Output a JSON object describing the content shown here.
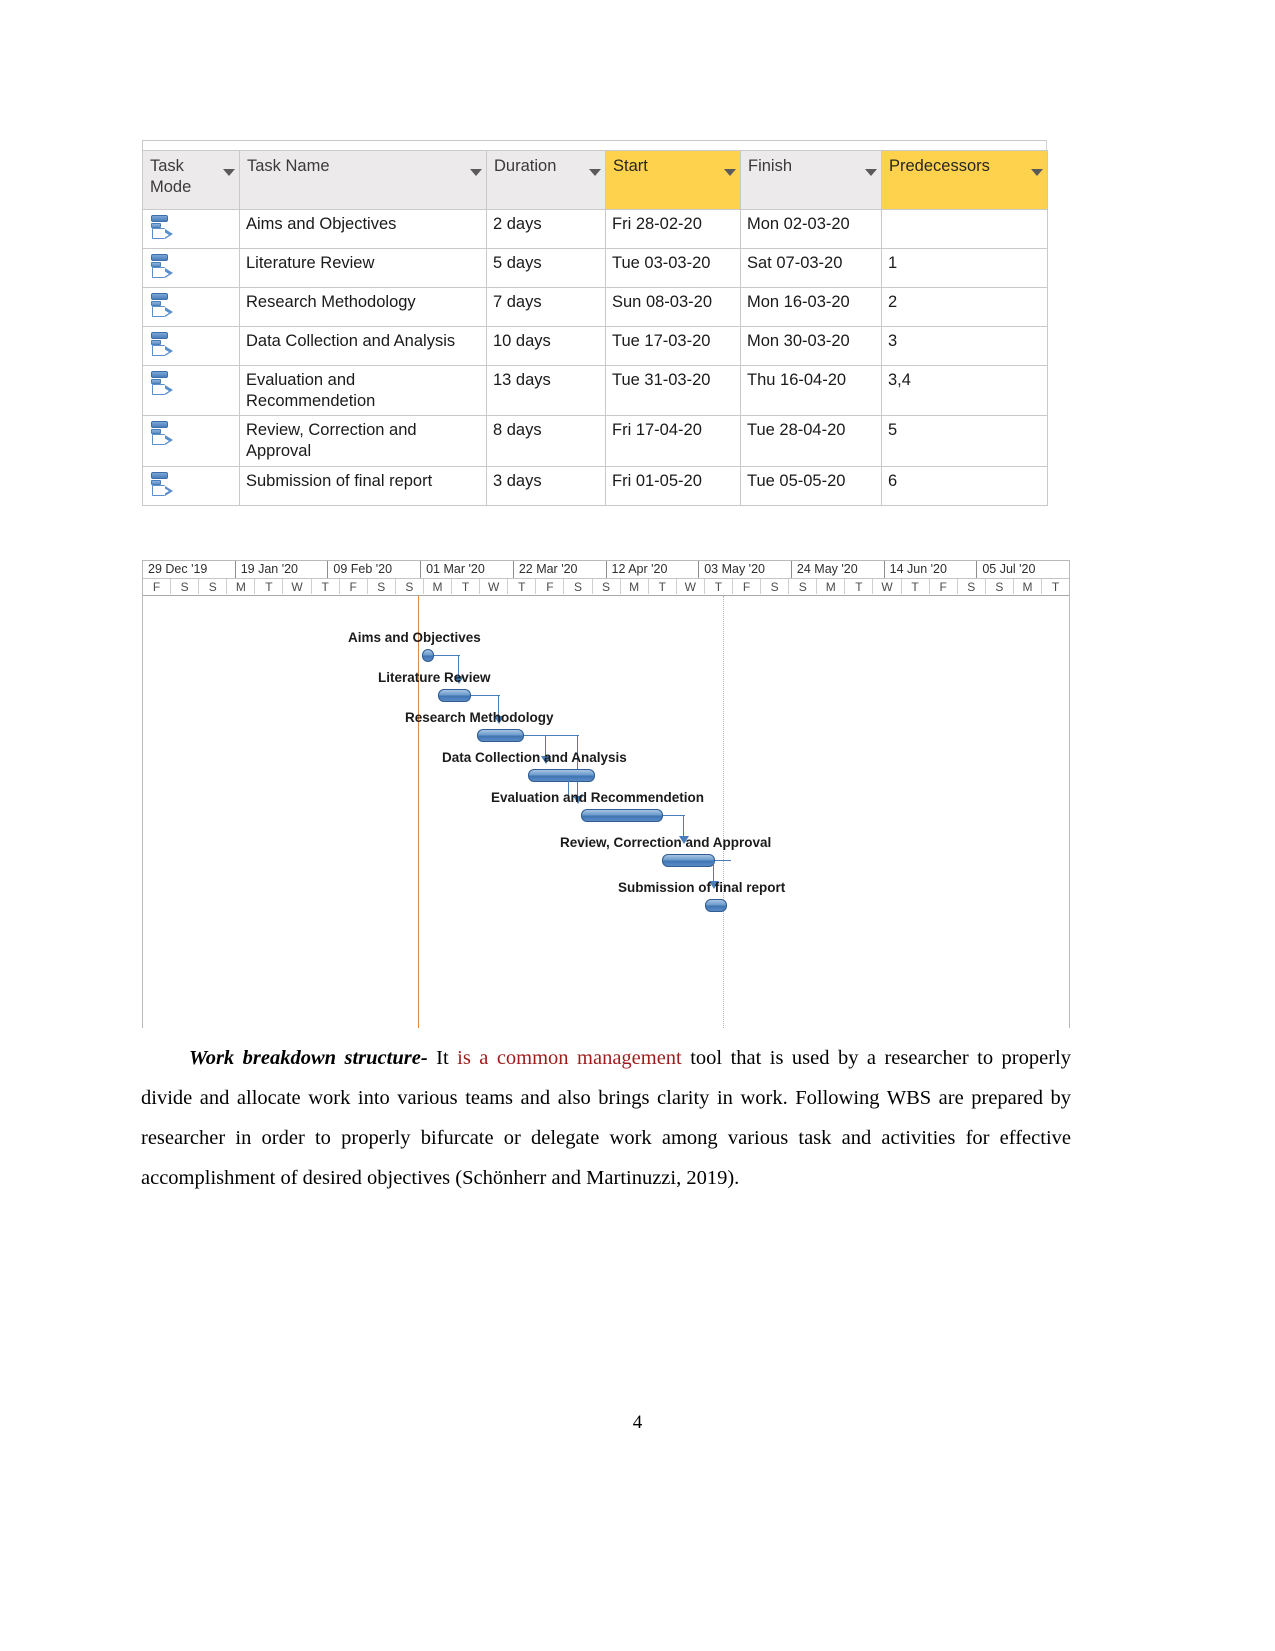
{
  "project_table": {
    "columns": [
      {
        "label": "Task\nMode",
        "highlighted": false,
        "has_filter": true
      },
      {
        "label": "Task Name",
        "highlighted": false,
        "has_filter": true
      },
      {
        "label": "Duration",
        "highlighted": false,
        "has_filter": true
      },
      {
        "label": "Start",
        "highlighted": true,
        "has_filter": true
      },
      {
        "label": "Finish",
        "highlighted": false,
        "has_filter": true
      },
      {
        "label": "Predecessors",
        "highlighted": true,
        "has_filter": true
      }
    ],
    "rows": [
      {
        "mode_icon": "auto-schedule-icon",
        "name": "Aims and Objectives",
        "duration": "2 days",
        "start": "Fri 28-02-20",
        "finish": "Mon 02-03-20",
        "predecessors": ""
      },
      {
        "mode_icon": "auto-schedule-icon",
        "name": "Literature Review",
        "duration": "5 days",
        "start": "Tue 03-03-20",
        "finish": "Sat 07-03-20",
        "predecessors": "1"
      },
      {
        "mode_icon": "auto-schedule-icon",
        "name": "Research Methodology",
        "duration": "7 days",
        "start": "Sun 08-03-20",
        "finish": "Mon 16-03-20",
        "predecessors": "2"
      },
      {
        "mode_icon": "auto-schedule-icon",
        "name": "Data Collection and Analysis",
        "duration": "10 days",
        "start": "Tue 17-03-20",
        "finish": "Mon 30-03-20",
        "predecessors": "3"
      },
      {
        "mode_icon": "auto-schedule-icon",
        "name": "Evaluation and Recommendetion",
        "duration": "13 days",
        "start": "Tue 31-03-20",
        "finish": "Thu 16-04-20",
        "predecessors": "3,4"
      },
      {
        "mode_icon": "auto-schedule-icon",
        "name": "Review, Correction and Approval",
        "duration": "8 days",
        "start": "Fri 17-04-20",
        "finish": "Tue 28-04-20",
        "predecessors": "5"
      },
      {
        "mode_icon": "auto-schedule-icon",
        "name": "Submission of final report",
        "duration": "3 days",
        "start": "Fri 01-05-20",
        "finish": "Tue 05-05-20",
        "predecessors": "6"
      }
    ]
  },
  "gantt": {
    "timeline_weeks": [
      "29 Dec '19",
      "19 Jan '20",
      "09 Feb '20",
      "01 Mar '20",
      "22 Mar '20",
      "12 Apr '20",
      "03 May '20",
      "24 May '20",
      "14 Jun '20",
      "05 Jul '20"
    ],
    "timeline_days": [
      "F",
      "S",
      "S",
      "M",
      "T",
      "W",
      "T",
      "F",
      "S",
      "S",
      "M",
      "T",
      "W",
      "T",
      "F",
      "S",
      "S",
      "M",
      "T",
      "W",
      "T",
      "F",
      "S",
      "S",
      "M",
      "T",
      "W",
      "T",
      "F",
      "S",
      "S",
      "M",
      "T"
    ],
    "bar_color": "#4a7ebb",
    "today_line_color": "#e08a4a",
    "bars": [
      {
        "label": "Aims and Objectives",
        "duration": "2 days"
      },
      {
        "label": "Literature Review",
        "duration": "5 days"
      },
      {
        "label": "Research Methodology",
        "duration": "7 days"
      },
      {
        "label": "Data Collection and Analysis",
        "duration": "10 days"
      },
      {
        "label": "Evaluation and Recommendetion",
        "duration": "13 days"
      },
      {
        "label": "Review, Correction and Approval",
        "duration": "8 days"
      },
      {
        "label": "Submission of final report",
        "duration": "3 days"
      }
    ]
  },
  "paragraph": {
    "lead": "Work breakdown structure-",
    "after_lead": " It ",
    "red_phrase": "is a common management",
    "rest": " tool that is used by a researcher to properly divide and allocate work into various teams and also brings clarity in work. Following WBS are prepared by researcher in order to properly bifurcate or delegate work among various task and activities for effective accomplishment of desired objectives (Schönherr and Martinuzzi, 2019)."
  },
  "footer": {
    "page_number": "4"
  }
}
